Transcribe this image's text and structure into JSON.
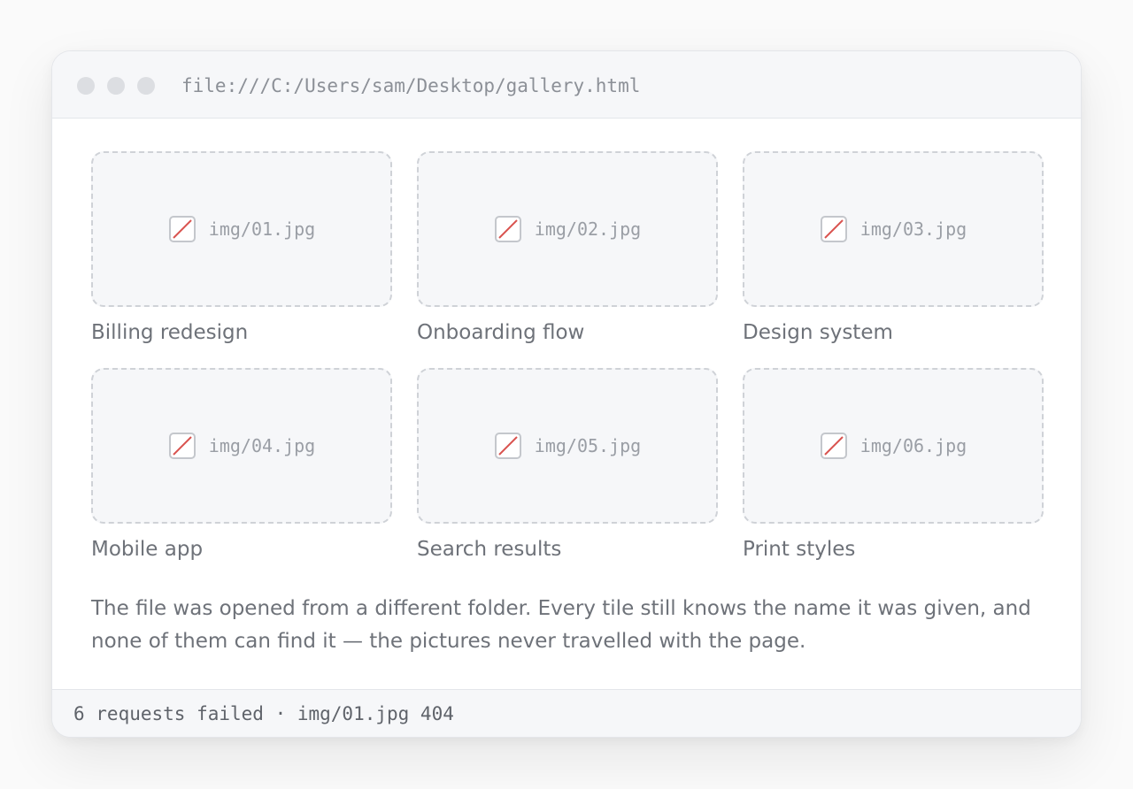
{
  "window": {
    "address": "file:///C:/Users/sam/Desktop/gallery.html",
    "traffic_lights": [
      "close-dot",
      "minimize-dot",
      "maximize-dot"
    ]
  },
  "gallery": {
    "tiles": [
      {
        "file": "img/01.jpg",
        "caption": "Billing redesign",
        "icon": "broken-image-icon"
      },
      {
        "file": "img/02.jpg",
        "caption": "Onboarding flow",
        "icon": "broken-image-icon"
      },
      {
        "file": "img/03.jpg",
        "caption": "Design system",
        "icon": "broken-image-icon"
      },
      {
        "file": "img/04.jpg",
        "caption": "Mobile app",
        "icon": "broken-image-icon"
      },
      {
        "file": "img/05.jpg",
        "caption": "Search results",
        "icon": "broken-image-icon"
      },
      {
        "file": "img/06.jpg",
        "caption": "Print styles",
        "icon": "broken-image-icon"
      }
    ],
    "note": "The file was opened from a different folder. Every tile still knows the name it was given, and none of them can find it — the pictures never travelled with the page."
  },
  "status_bar": {
    "text": "6 requests failed · img/01.jpg 404"
  },
  "colors": {
    "broken_icon_slash": "#d9534f",
    "frame_border": "#cfd2d7",
    "frame_fill": "#f6f7f9",
    "chrome_fill": "#f6f7f9"
  }
}
